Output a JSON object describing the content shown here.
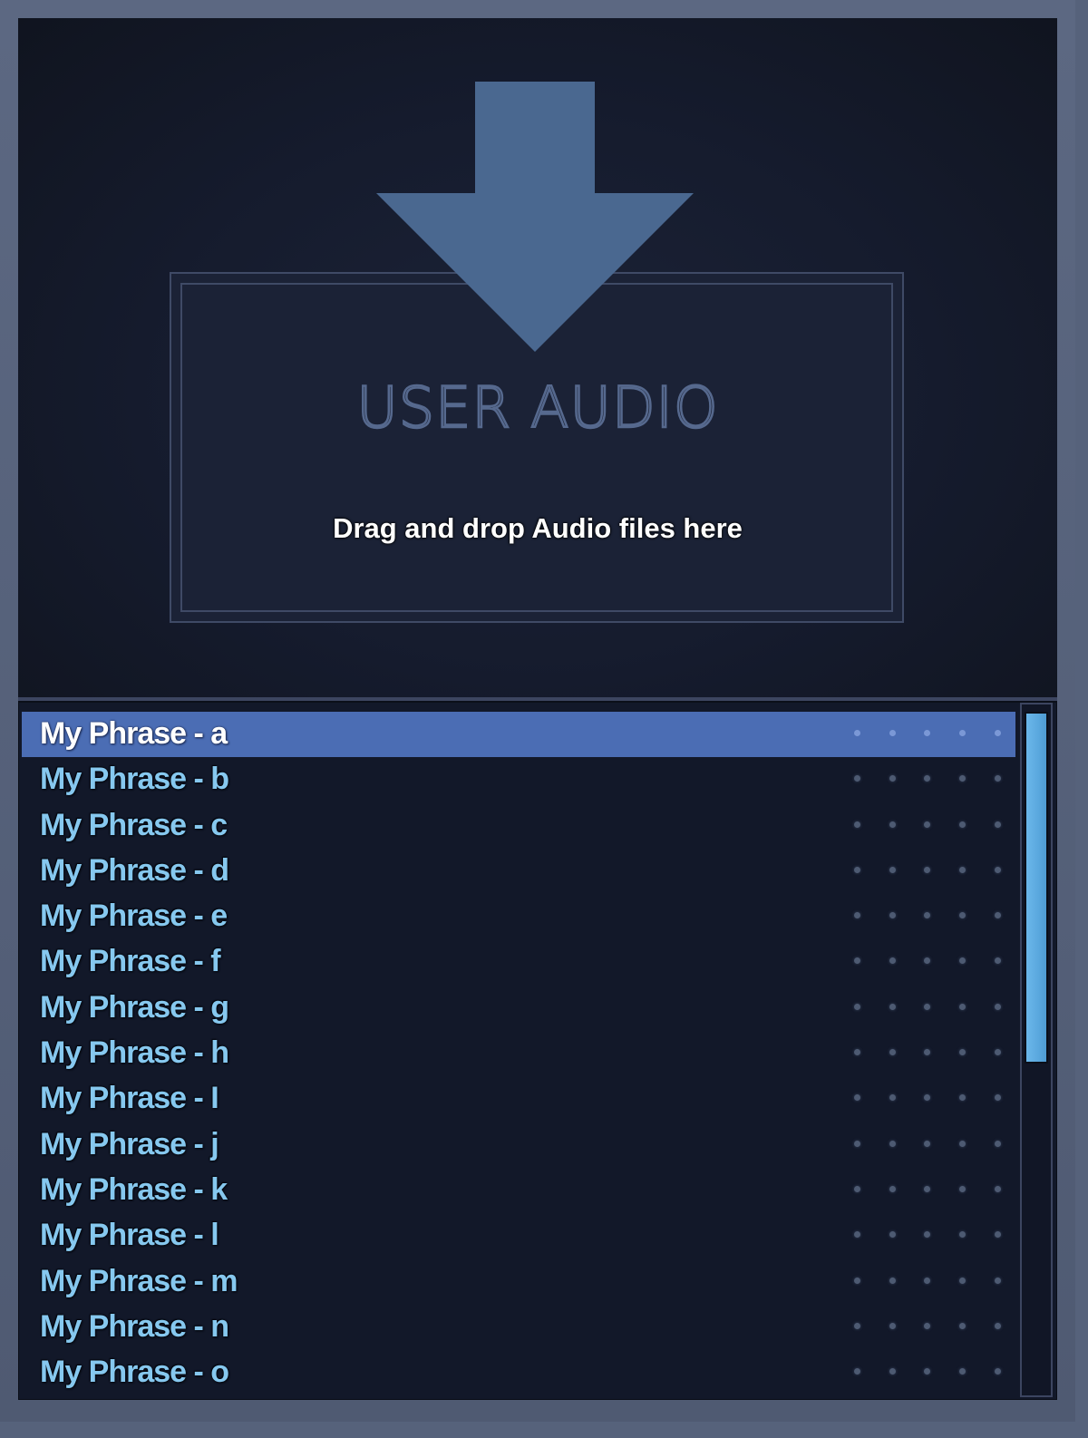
{
  "dropzone": {
    "title": "USER AUDIO",
    "hint": "Drag and drop Audio files here",
    "icon": "download-arrow-icon",
    "arrow_color": "#4a6890"
  },
  "list": {
    "selected_index": 0,
    "selected_color": "#4b6db4",
    "text_color": "#86c8ef",
    "items": [
      {
        "label": "My Phrase - a"
      },
      {
        "label": "My Phrase - b"
      },
      {
        "label": "My Phrase - c"
      },
      {
        "label": "My Phrase - d"
      },
      {
        "label": "My Phrase - e"
      },
      {
        "label": "My Phrase - f"
      },
      {
        "label": "My Phrase - g"
      },
      {
        "label": "My Phrase - h"
      },
      {
        "label": "My Phrase - I"
      },
      {
        "label": "My Phrase - j"
      },
      {
        "label": "My Phrase - k"
      },
      {
        "label": "My Phrase - l"
      },
      {
        "label": "My Phrase - m"
      },
      {
        "label": "My Phrase - n"
      },
      {
        "label": "My Phrase - o"
      }
    ]
  },
  "scrollbar": {
    "thumb_color": "#5aaae0",
    "visible_fraction": 0.52,
    "position_fraction": 0.0
  }
}
